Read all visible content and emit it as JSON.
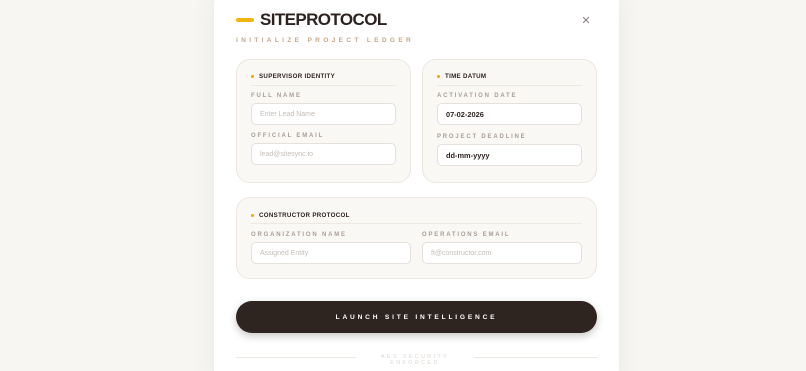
{
  "header": {
    "title": "SITEPROTOCOL",
    "subtitle": "INITIALIZE PROJECT LEDGER",
    "close_icon": "close-icon"
  },
  "supervisor": {
    "title": "SUPERVISOR IDENTITY",
    "full_name_label": "FULL NAME",
    "full_name_placeholder": "Enter Lead Name",
    "email_label": "OFFICIAL EMAIL",
    "email_placeholder": "lead@sitesync.io"
  },
  "time": {
    "title": "TIME DATUM",
    "activation_label": "ACTIVATION DATE",
    "activation_value": "07-02-2026",
    "deadline_label": "PROJECT DEADLINE",
    "deadline_value": "dd-mm-yyyy"
  },
  "constructor": {
    "title": "CONSTRUCTOR PROTOCOL",
    "org_label": "ORGANIZATION NAME",
    "org_placeholder": "Assigned Entity",
    "ops_label": "OPERATIONS EMAIL",
    "ops_placeholder": "ft@constructor.com"
  },
  "actions": {
    "launch_label": "LAUNCH SITE INTELLIGENCE"
  },
  "footer": {
    "text": "AES SECURITY ENFORCED"
  },
  "colors": {
    "accent": "#f2b40f",
    "button": "#2e2420",
    "background": "#f7f6f2"
  }
}
